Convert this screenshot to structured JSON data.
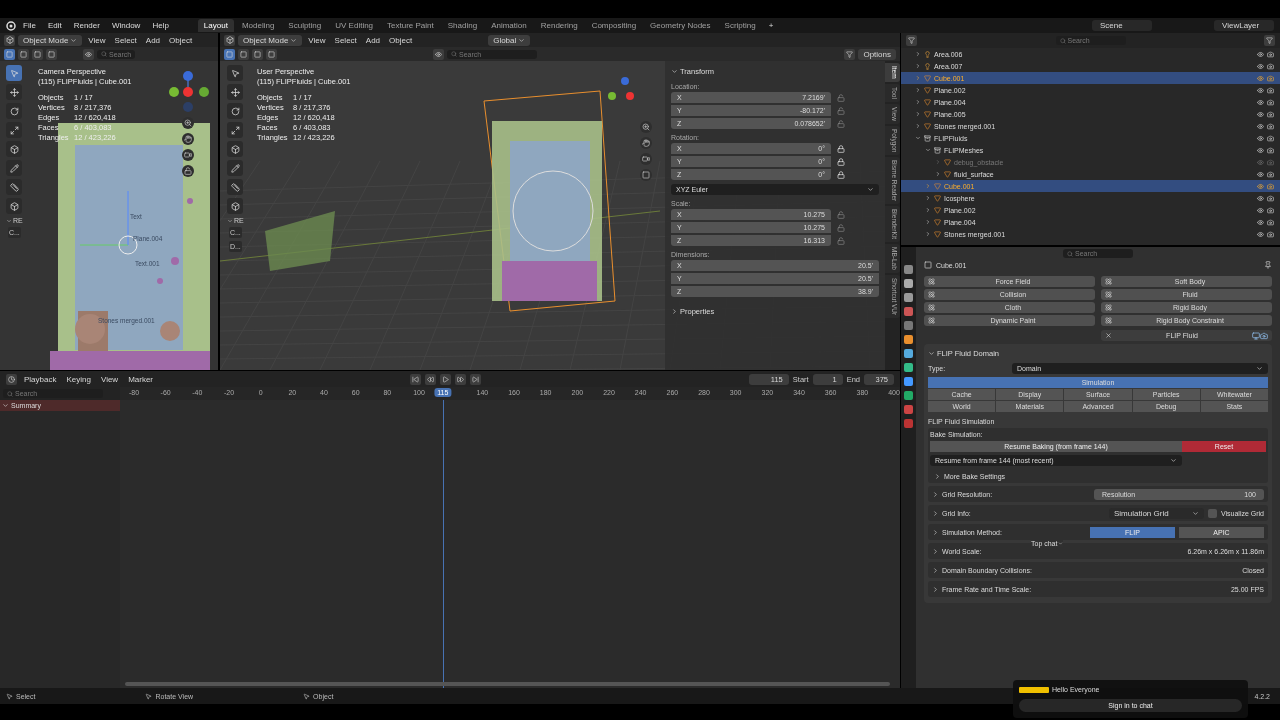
{
  "top_bar": {
    "menus": [
      "File",
      "Edit",
      "Render",
      "Window",
      "Help"
    ],
    "workspaces": [
      {
        "label": "Layout",
        "selected": true
      },
      {
        "label": "Modeling",
        "selected": false
      },
      {
        "label": "Sculpting",
        "selected": false
      },
      {
        "label": "UV Editing",
        "selected": false
      },
      {
        "label": "Texture Paint",
        "selected": false
      },
      {
        "label": "Shading",
        "selected": false
      },
      {
        "label": "Animation",
        "selected": false
      },
      {
        "label": "Rendering",
        "selected": false
      },
      {
        "label": "Compositing",
        "selected": false
      },
      {
        "label": "Geometry Nodes",
        "selected": false
      },
      {
        "label": "Scripting",
        "selected": false
      }
    ],
    "add_workspace": "+",
    "scene": "Scene",
    "view_layer": "ViewLayer"
  },
  "camera_view": {
    "mode": "Object Mode",
    "menus": [
      "View",
      "Select",
      "Add",
      "Object"
    ],
    "search_placeholder": "Search",
    "title": "Camera Perspective",
    "context": "(115) FLIPFluids | Cube.001",
    "stats": [
      {
        "label": "Objects",
        "value": "1 / 17"
      },
      {
        "label": "Vertices",
        "value": "8 / 217,376"
      },
      {
        "label": "Edges",
        "value": "12 / 620,418"
      },
      {
        "label": "Faces",
        "value": "6 / 403,083"
      },
      {
        "label": "Triangles",
        "value": "12 / 423,226"
      }
    ],
    "object_labels": [
      "Text",
      "Plane.004",
      "Text.001",
      "Stones merged.001"
    ],
    "panel_heading": "RE",
    "panel_buttons": [
      "C..."
    ]
  },
  "user_view": {
    "mode": "Object Mode",
    "menus": [
      "View",
      "Select",
      "Add",
      "Object"
    ],
    "orientation": "Global",
    "search_placeholder": "Search",
    "options": "Options",
    "title": "User Perspective",
    "context": "(115) FLIPFluids | Cube.001",
    "stats": [
      {
        "label": "Objects",
        "value": "1 / 17"
      },
      {
        "label": "Vertices",
        "value": "8 / 217,376"
      },
      {
        "label": "Edges",
        "value": "12 / 620,418"
      },
      {
        "label": "Faces",
        "value": "6 / 403,083"
      },
      {
        "label": "Triangles",
        "value": "12 / 423,226"
      }
    ],
    "panel_heading": "RE",
    "panel_buttons": [
      "C...",
      "D..."
    ]
  },
  "sidebar": {
    "tabs": [
      {
        "label": "Item",
        "selected": true
      },
      {
        "label": "Tool",
        "selected": false
      },
      {
        "label": "View",
        "selected": false
      },
      {
        "label": "Polygon",
        "selected": false
      },
      {
        "label": "Bisme Reader",
        "selected": false
      },
      {
        "label": "BlenderKit",
        "selected": false
      },
      {
        "label": "MB-Lab",
        "selected": false
      },
      {
        "label": "Shortcut VUr",
        "selected": false
      }
    ],
    "panel": "Transform",
    "groups": [
      {
        "label": "Location:",
        "fields": [
          {
            "axis": "X",
            "value": "7.2169'",
            "locked": false
          },
          {
            "axis": "Y",
            "value": "-80.172'",
            "locked": false
          },
          {
            "axis": "Z",
            "value": "0.078652'",
            "locked": false
          }
        ]
      },
      {
        "label": "Rotation:",
        "fields": [
          {
            "axis": "X",
            "value": "0°",
            "locked": true
          },
          {
            "axis": "Y",
            "value": "0°",
            "locked": true
          },
          {
            "axis": "Z",
            "value": "0°",
            "locked": true
          }
        ],
        "mode": "XYZ Euler"
      },
      {
        "label": "Scale:",
        "fields": [
          {
            "axis": "X",
            "value": "10.275",
            "locked": false
          },
          {
            "axis": "Y",
            "value": "10.275",
            "locked": false
          },
          {
            "axis": "Z",
            "value": "16.313",
            "locked": false
          }
        ]
      },
      {
        "label": "Dimensions:",
        "fields": [
          {
            "axis": "X",
            "value": "20.5'"
          },
          {
            "axis": "Y",
            "value": "20.5'"
          },
          {
            "axis": "Z",
            "value": "38.9'"
          }
        ]
      }
    ],
    "properties": "Properties"
  },
  "outliner": {
    "search_placeholder": "Search",
    "rows": [
      {
        "name": "Area.006",
        "kind": "light",
        "selected": false,
        "disabled": false
      },
      {
        "name": "Area.007",
        "kind": "light",
        "selected": false,
        "disabled": false
      },
      {
        "name": "Cube.001",
        "kind": "mesh",
        "selected": true,
        "disabled": false
      },
      {
        "name": "Plane.002",
        "kind": "mesh",
        "selected": false,
        "disabled": false
      },
      {
        "name": "Plane.004",
        "kind": "mesh",
        "selected": false,
        "disabled": false
      },
      {
        "name": "Plane.005",
        "kind": "mesh",
        "selected": false,
        "disabled": false
      },
      {
        "name": "Stones merged.001",
        "kind": "mesh",
        "selected": false,
        "disabled": false
      },
      {
        "name": "FLIPFluids",
        "kind": "collection",
        "selected": false,
        "disabled": false,
        "expanded": true,
        "children": [
          {
            "name": "FLIPMeshes",
            "kind": "collection",
            "selected": false,
            "disabled": false,
            "expanded": true,
            "children": [
              {
                "name": "debug_obstacle",
                "kind": "mesh",
                "selected": false,
                "disabled": true
              },
              {
                "name": "fluid_surface",
                "kind": "mesh",
                "selected": false,
                "disabled": false
              }
            ]
          },
          {
            "name": "Cube.001",
            "kind": "mesh",
            "selected": true,
            "disabled": false
          },
          {
            "name": "Icosphere",
            "kind": "mesh",
            "selected": false,
            "disabled": false
          },
          {
            "name": "Plane.002",
            "kind": "mesh",
            "selected": false,
            "disabled": false
          },
          {
            "name": "Plane.004",
            "kind": "mesh",
            "selected": false,
            "disabled": false
          },
          {
            "name": "Stones merged.001",
            "kind": "mesh",
            "selected": false,
            "disabled": false
          }
        ]
      }
    ]
  },
  "properties": {
    "search_placeholder": "Search",
    "object": "Cube.001",
    "physics_left": [
      "Force Field",
      "Collision",
      "Cloth",
      "Dynamic Paint"
    ],
    "physics_right": [
      "Soft Body",
      "Fluid",
      "Rigid Body",
      "Rigid Body Constraint"
    ],
    "enabled_physics": "FLIP Fluid",
    "domain": {
      "title": "FLIP Fluid Domain",
      "type_label": "Type:",
      "type": "Domain",
      "tabs": [
        {
          "label": "Simulation",
          "selected": true
        },
        {
          "label": "Cache",
          "selected": false
        },
        {
          "label": "Display",
          "selected": false
        },
        {
          "label": "Surface",
          "selected": false
        },
        {
          "label": "Particles",
          "selected": false
        },
        {
          "label": "Whitewater",
          "selected": false
        },
        {
          "label": "World",
          "selected": false
        },
        {
          "label": "Materials",
          "selected": false
        },
        {
          "label": "Advanced",
          "selected": false
        },
        {
          "label": "Debug",
          "selected": false
        },
        {
          "label": "Stats",
          "selected": false
        }
      ],
      "section": "FLIP Fluid Simulation",
      "bake": {
        "title": "Bake Simulation:",
        "resume": "Resume Baking  (from frame 144)",
        "reset": "Reset",
        "resume_from": "Resume from frame 144 (most recent)",
        "more": "More Bake Settings"
      },
      "rows": [
        {
          "kind": "slider",
          "label": "Grid Resolution:",
          "field": "Resolution",
          "value": "100"
        },
        {
          "kind": "dropdown",
          "label": "Grid Info:",
          "value": "Simulation Grid",
          "checkbox": "Visualize Grid",
          "checked": false
        },
        {
          "kind": "toggle",
          "label": "Simulation Method:",
          "options": [
            {
              "label": "FLIP",
              "selected": true
            },
            {
              "label": "APIC",
              "selected": false
            }
          ]
        },
        {
          "kind": "text",
          "label": "World Scale:",
          "value": "6.26m  x  6.26m  x  11.86m"
        },
        {
          "kind": "text",
          "label": "Domain Boundary Collisions:",
          "value": "Closed"
        },
        {
          "kind": "text",
          "label": "Frame Rate and Time Scale:",
          "value": "25.00 FPS"
        }
      ]
    }
  },
  "timeline": {
    "menus": [
      "Playback",
      "Keying",
      "View",
      "Marker"
    ],
    "current_frame": "115",
    "start_label": "Start",
    "start": "1",
    "end_label": "End",
    "end": "375",
    "search_placeholder": "Search",
    "channels": [
      {
        "label": "Summary",
        "expanded": true
      }
    ],
    "ticks": [
      "-80",
      "-60",
      "-40",
      "-20",
      "0",
      "20",
      "40",
      "60",
      "80",
      "100",
      "140",
      "160",
      "180",
      "200",
      "220",
      "240",
      "260",
      "280",
      "300",
      "320",
      "340",
      "360",
      "380",
      "400"
    ],
    "playhead_label": "115"
  },
  "status_bar": {
    "items": [
      "Select",
      "Rotate View",
      "Object"
    ],
    "version": "4.2.2"
  },
  "chat_overlay": {
    "menu": "Top chat",
    "message": "Hello Everyone",
    "button": "Sign in to chat"
  }
}
